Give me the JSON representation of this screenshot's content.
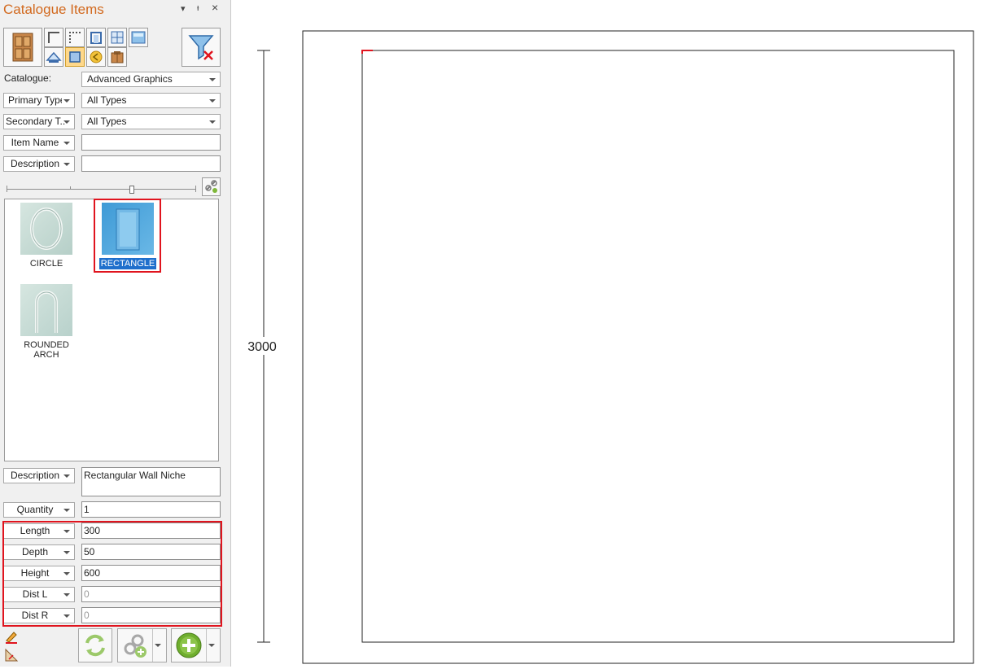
{
  "panel": {
    "title": "Catalogue Items",
    "dropdown_glyph": "▾",
    "pin_glyph": "ᵻ",
    "close_glyph": "×"
  },
  "toolbar": {
    "icons": [
      "door-icon",
      "corner-icon",
      "corner-dots-icon",
      "niche-icon",
      "window-grid-icon",
      "picture-icon",
      "roof-icon",
      "square-frame-icon",
      "arrow-circle-icon",
      "cabinet-icon",
      "filter-clear-icon"
    ]
  },
  "filters": {
    "catalogue_label": "Catalogue:",
    "catalogue_value": "Advanced Graphics",
    "primary_type_label": "Primary Type",
    "primary_type_value": "All Types",
    "secondary_type_label": "Secondary T...",
    "secondary_type_value": "All Types",
    "item_name_label": "Item Name",
    "item_name_value": "",
    "description_label": "Description",
    "description_value": ""
  },
  "gallery": {
    "items": [
      {
        "label": "CIRCLE",
        "selected": false
      },
      {
        "label": "RECTANGLE",
        "selected": true
      },
      {
        "label": "ROUNDED ARCH",
        "selected": false
      }
    ]
  },
  "properties": {
    "description_label": "Description",
    "description_value": "Rectangular Wall Niche",
    "quantity_label": "Quantity",
    "quantity_value": "1",
    "length_label": "Length",
    "length_value": "300",
    "depth_label": "Depth",
    "depth_value": "50",
    "height_label": "Height",
    "height_value": "600",
    "dist_l_label": "Dist L",
    "dist_l_value": "0",
    "dist_r_label": "Dist R",
    "dist_r_value": "0"
  },
  "drawing": {
    "dimension_label": "3000"
  },
  "colors": {
    "accent_title": "#d2691e",
    "highlight_red": "#e0141e",
    "selection_blue": "#1f6fcc"
  }
}
